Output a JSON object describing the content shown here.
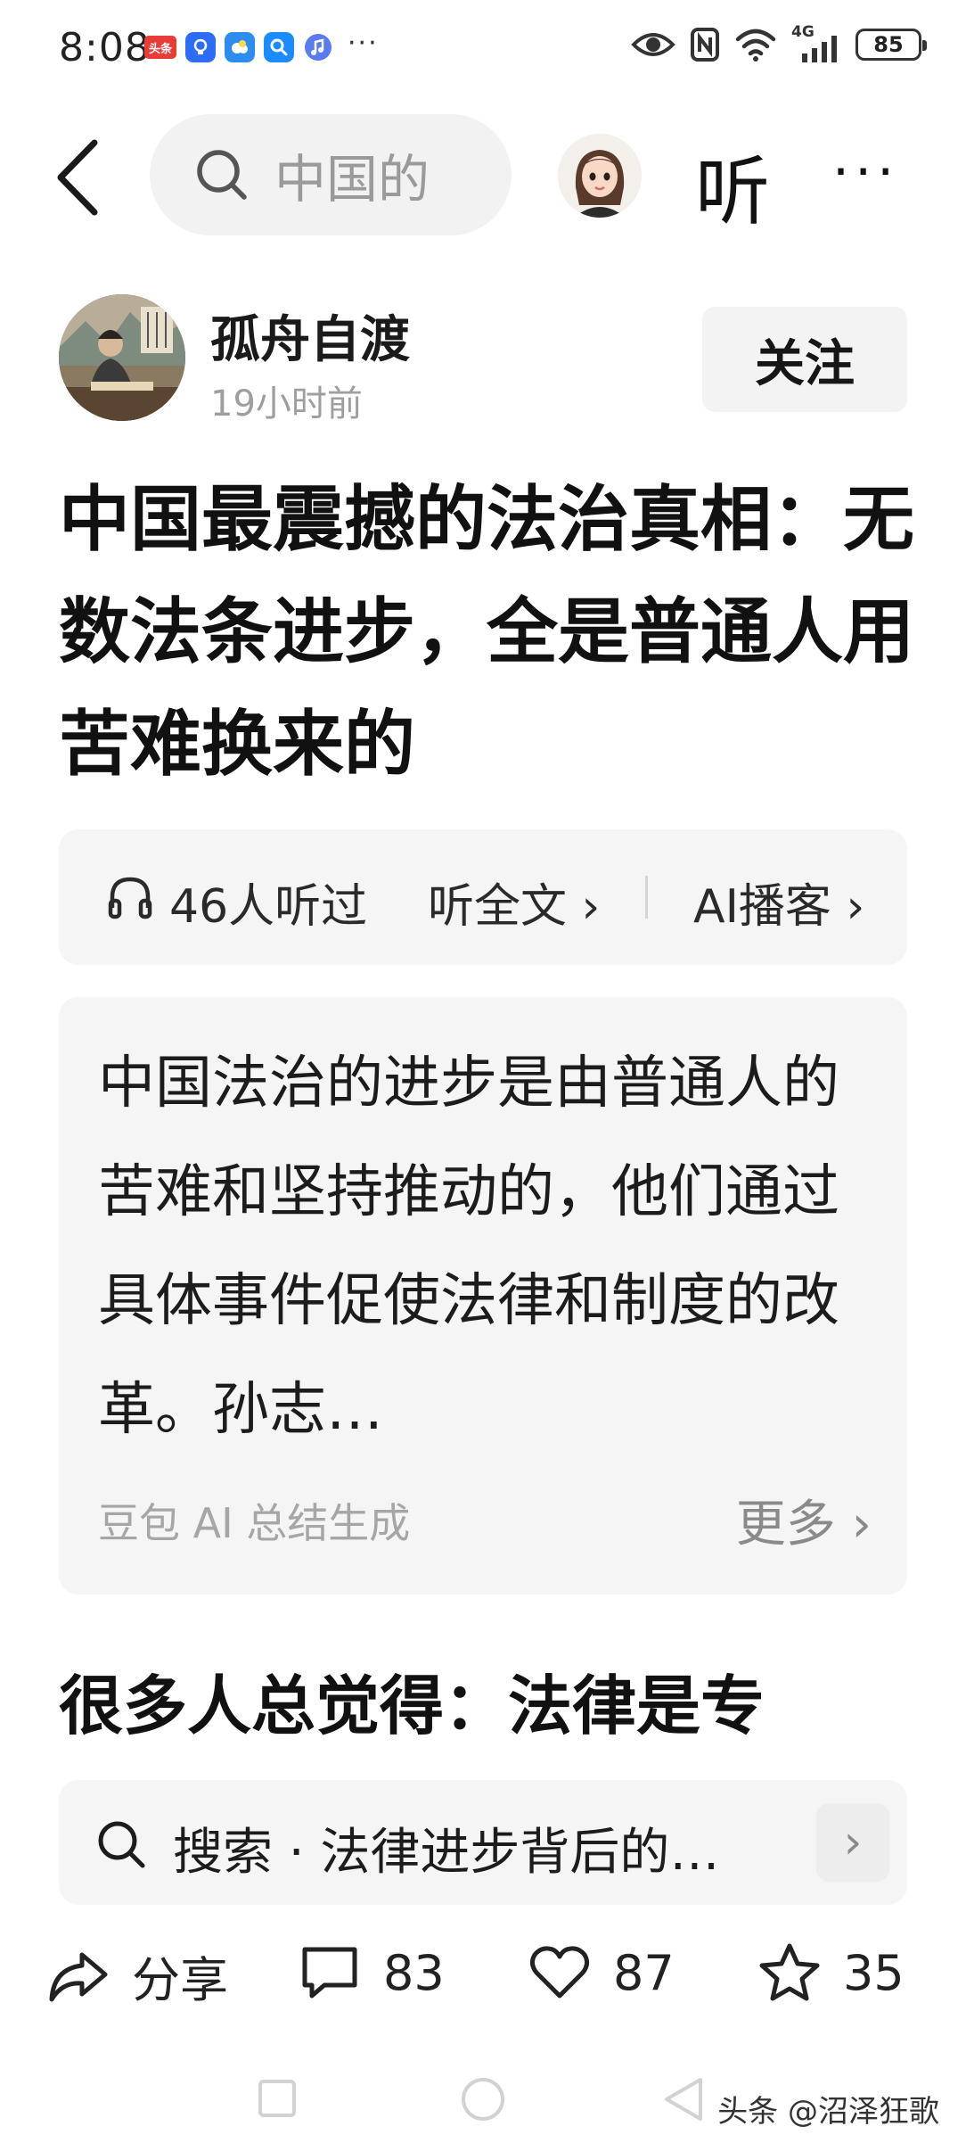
{
  "status_bar": {
    "time": "8:08",
    "toutiao_badge": "头条",
    "more_dots": "···",
    "battery": "85",
    "network": "4G"
  },
  "nav": {
    "search_text": "中国的",
    "listen_label": "听",
    "more_label": "···"
  },
  "author": {
    "name": "孤舟自渡",
    "time": "19小时前",
    "follow_label": "关注"
  },
  "article": {
    "title": "中国最震撼的法治真相：无数法条进步，全是普通人用苦难换来的",
    "first_line": "很多人总觉得：法律是专"
  },
  "listen_bar": {
    "count": "46人听过",
    "full_text": "听全文",
    "podcast": "AI播客"
  },
  "summary": {
    "text": "中国法治的进步是由普通人的苦难和坚持推动的，他们通过具体事件促使法律和制度的改革。孙志…",
    "source": "豆包 AI 总结生成",
    "more": "更多"
  },
  "search_suggestion": {
    "text": "搜索 · 法律进步背后的…"
  },
  "actions": {
    "share": "分享",
    "comments": "83",
    "likes": "87",
    "favorites": "35"
  },
  "watermark": "头条 @沼泽狂歌",
  "colors": {
    "background": "#ffffff",
    "card": "#f5f5f5",
    "muted_text": "#9e9e9e"
  }
}
